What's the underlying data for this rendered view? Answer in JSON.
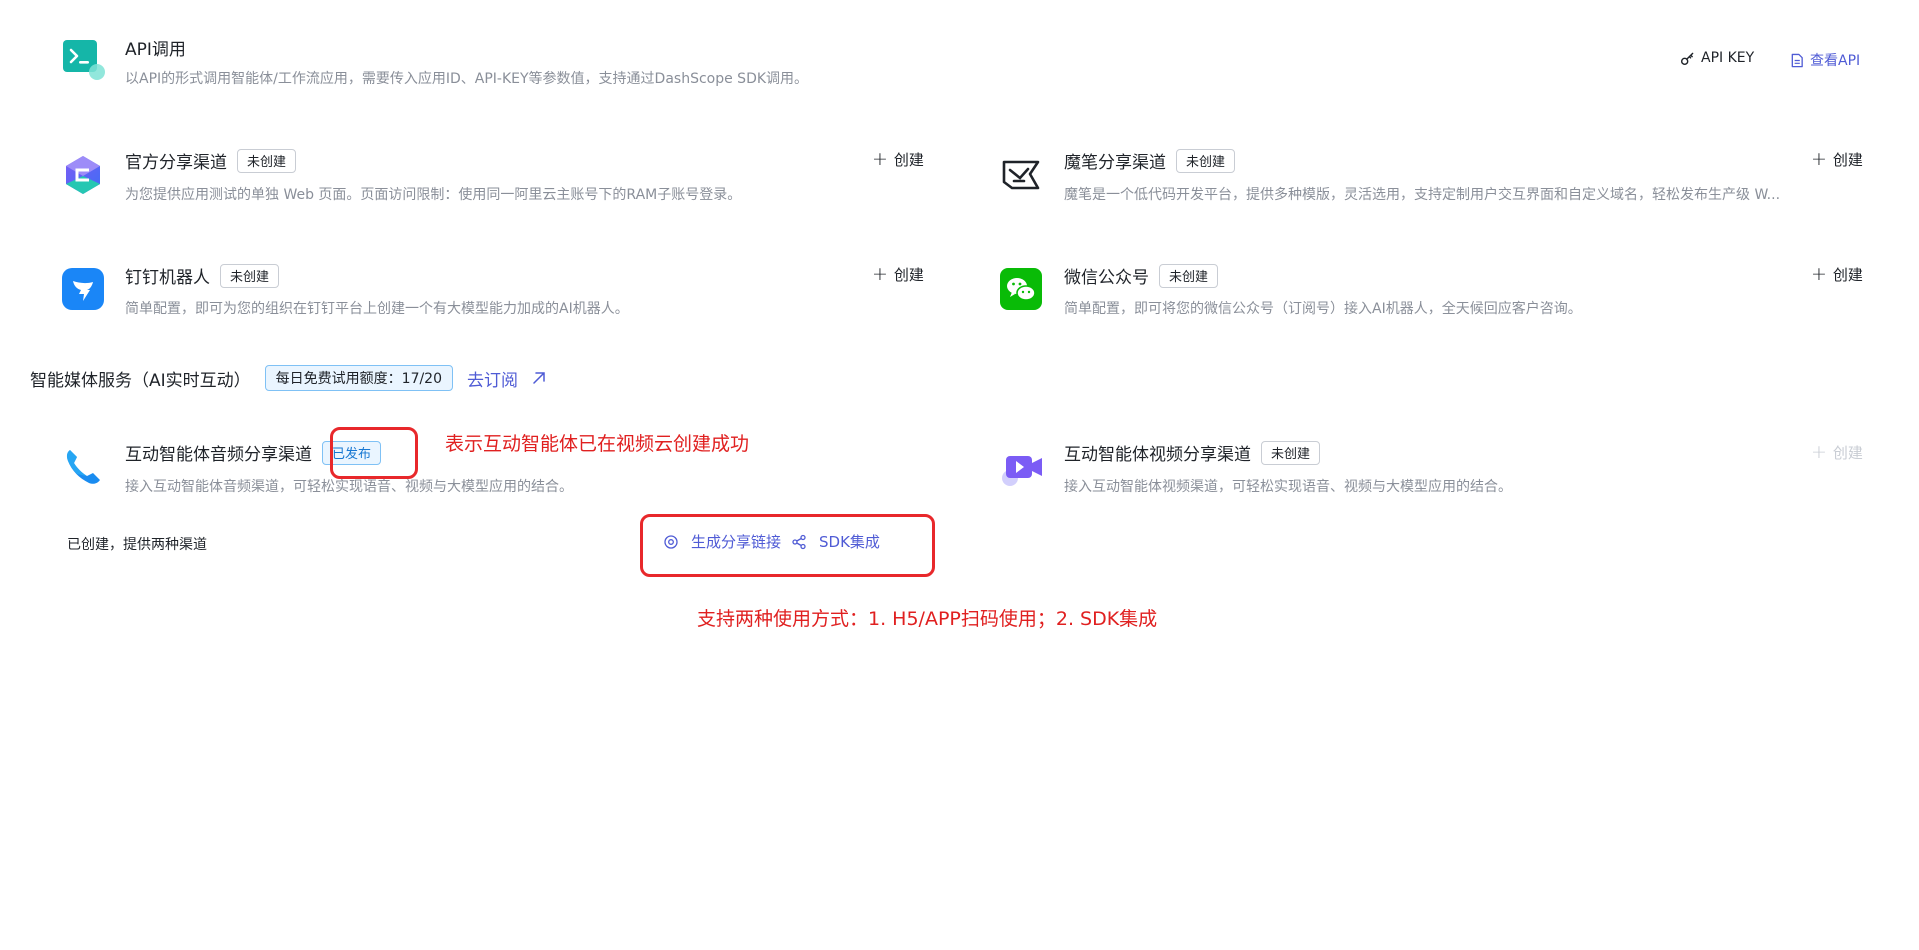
{
  "api": {
    "title": "API调用",
    "desc": "以API的形式调用智能体/工作流应用，需要传入应用ID、API-KEY等参数值，支持通过DashScope SDK调用。",
    "api_key_label": "API KEY",
    "view_api_label": "查看API"
  },
  "channels": {
    "official": {
      "title": "官方分享渠道",
      "badge": "未创建",
      "desc": "为您提供应用测试的单独 Web 页面。页面访问限制：使用同一阿里云主账号下的RAM子账号登录。",
      "create": "创建"
    },
    "mobi": {
      "title": "魔笔分享渠道",
      "badge": "未创建",
      "desc": "魔笔是一个低代码开发平台，提供多种模版，灵活选用，支持定制用户交互界面和自定义域名，轻松发布生产级 W...",
      "create": "创建"
    },
    "dingtalk": {
      "title": "钉钉机器人",
      "badge": "未创建",
      "desc": "简单配置，即可为您的组织在钉钉平台上创建一个有大模型能力加成的AI机器人。",
      "create": "创建"
    },
    "wechat": {
      "title": "微信公众号",
      "badge": "未创建",
      "desc": "简单配置，即可将您的微信公众号（订阅号）接入AI机器人，全天候回应客户咨询。",
      "create": "创建"
    }
  },
  "media": {
    "section_title": "智能媒体服务（AI实时互动）",
    "quota_badge": "每日免费试用额度：17/20",
    "subscribe_label": "去订阅",
    "audio": {
      "title": "互动智能体音频分享渠道",
      "badge": "已发布",
      "desc": "接入互动智能体音频渠道，可轻松实现语音、视频与大模型应用的结合。",
      "status_text": "已创建，提供两种渠道",
      "share_link_label": "生成分享链接",
      "sdk_label": "SDK集成"
    },
    "video": {
      "title": "互动智能体视频分享渠道",
      "badge": "未创建",
      "desc": "接入互动智能体视频渠道，可轻松实现语音、视频与大模型应用的结合。",
      "create": "创建"
    }
  },
  "annotations": {
    "published_note": "表示互动智能体已在视频云创建成功",
    "usage_note": "支持两种使用方式：1. H5/APP扫码使用；2. SDK集成"
  },
  "colors": {
    "accent": "#4f5bd5",
    "annotation_red": "#e02020",
    "published_blue": "#1677d2"
  }
}
